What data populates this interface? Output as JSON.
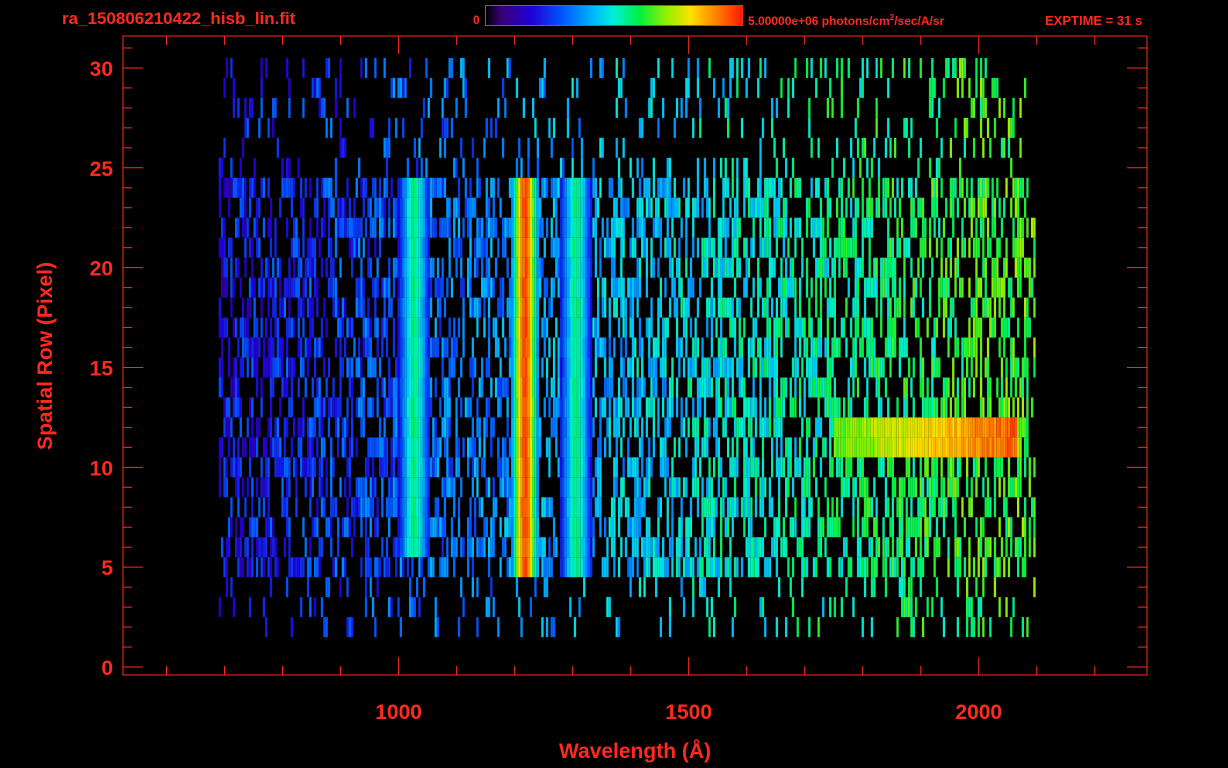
{
  "header": {
    "filename": "ra_150806210422_hisb_lin.fit",
    "colorbar_min_label": "0",
    "colorbar_max_value": "5.00000e+06 photons/cm",
    "colorbar_max_exp": "2",
    "colorbar_max_unit": "/sec/A/sr",
    "exptime_label": "EXPTIME = 31 s"
  },
  "colors": {
    "axis": "#ff2a1f",
    "background": "#000000",
    "colormap": [
      "#3a0077",
      "#1f00d8",
      "#0058ff",
      "#00b8ff",
      "#00f0d8",
      "#00f040",
      "#8cf000",
      "#ffe000",
      "#ff8000",
      "#ff1a00"
    ]
  },
  "chart_data": {
    "type": "heatmap",
    "title": "ra_150806210422_hisb_lin.fit",
    "xlabel": "Wavelength (Å)",
    "ylabel": "Spatial Row (Pixel)",
    "xlim": [
      525,
      2290
    ],
    "ylim": [
      -0.4,
      31.6
    ],
    "xticks": [
      1000,
      1500,
      2000
    ],
    "yticks": [
      0,
      5,
      10,
      15,
      20,
      25,
      30
    ],
    "colorbar_range": [
      0,
      5000000
    ],
    "colorbar_unit": "photons/cm^2/sec/A/sr",
    "exptime_s": 31,
    "data_extent": {
      "wavelength": [
        690,
        2095
      ],
      "rows": [
        1.5,
        30.5
      ]
    },
    "bright_features": [
      {
        "type": "emission_line",
        "wavelength": 1216,
        "rows": [
          4.5,
          24
        ],
        "level": "high"
      },
      {
        "type": "emission_line",
        "wavelength": 1025,
        "rows": [
          6,
          24
        ],
        "level": "medium"
      },
      {
        "type": "emission_line",
        "wavelength": 1304,
        "rows": [
          5,
          24
        ],
        "level": "medium"
      },
      {
        "type": "continuum_band",
        "wavelength": [
          1750,
          2065
        ],
        "rows": [
          10.5,
          12.5
        ],
        "level": "high"
      }
    ]
  }
}
